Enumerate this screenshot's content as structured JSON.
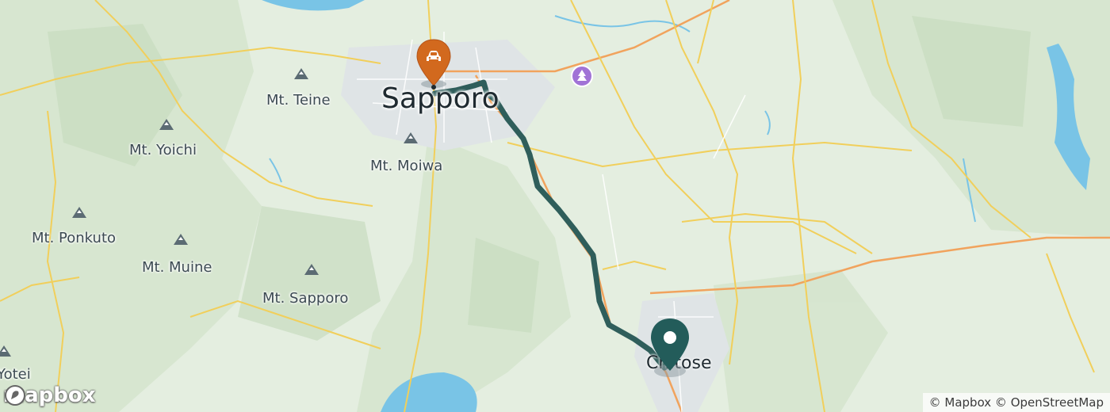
{
  "map": {
    "cities": [
      {
        "id": "sapporo",
        "name": "Sapporo"
      },
      {
        "id": "chitose",
        "name": "Chitose"
      }
    ],
    "mountains": [
      {
        "id": "teine",
        "name": "Mt. Teine"
      },
      {
        "id": "yoichi",
        "name": "Mt. Yoichi"
      },
      {
        "id": "moiwa",
        "name": "Mt. Moiwa"
      },
      {
        "id": "ponkuto",
        "name": "Mt. Ponkuto"
      },
      {
        "id": "muine",
        "name": "Mt. Muine"
      },
      {
        "id": "sapporo-mt",
        "name": "Mt. Sapporo"
      }
    ],
    "partial_label": "Yotei",
    "origin_marker": {
      "icon": "car-icon",
      "color": "#d2691e"
    },
    "destination_marker": {
      "icon": "pin-icon",
      "color": "#235c5a"
    },
    "route": {
      "color": "#2f5e5b"
    },
    "poi": {
      "icon": "park-icon",
      "color": "#a173d6"
    },
    "logo": "mapbox",
    "attribution": "© Mapbox © OpenStreetMap"
  }
}
